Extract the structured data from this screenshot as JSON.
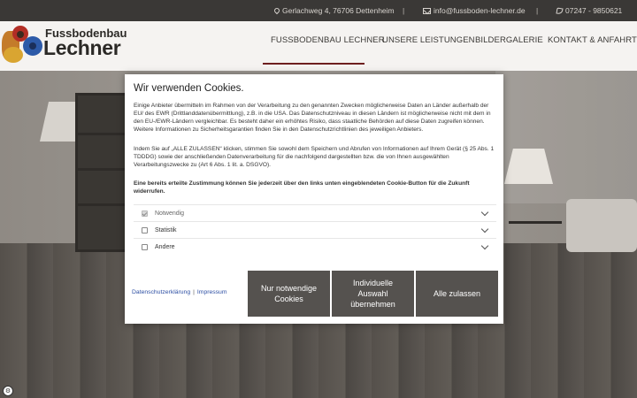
{
  "topbar": {
    "address": "Gerlachweg 4, 76706 Dettenheim",
    "email": "info@fussboden-lechner.de",
    "phone": "07247 - 9850621",
    "separator": "|"
  },
  "brand": {
    "line1": "Fussbodenbau",
    "line2": "Lechner"
  },
  "nav": {
    "items": [
      {
        "label": "FUSSBODENBAU LECHNER"
      },
      {
        "label": "UNSERE LEISTUNGEN"
      },
      {
        "label": "BILDERGALERIE"
      },
      {
        "label": "KONTAKT & ANFAHRT"
      }
    ],
    "accent": "#6e1f1f"
  },
  "cookie": {
    "title": "Wir verwenden Cookies.",
    "para1": "Einige Anbieter übermitteln im Rahmen von der Verarbeitung zu den genannten Zwecken möglicherweise Daten an Länder außerhalb der EU/ des EWR (Drittlanddatenübermittlung), z.B. in die USA. Das Datenschutzniveau in diesen Ländern ist möglicherweise nicht mit dem in den EU-/EWR-Ländern vergleichbar. Es besteht daher ein erhöhtes Risiko, dass staatliche Behörden auf diese Daten zugreifen können. Weitere Informationen zu Sicherheitsgarantien finden Sie in den Datenschutzrichtlinien des jeweiligen Anbieters.",
    "para2": "Indem Sie auf „ALLE ZULASSEN“ klicken, stimmen Sie sowohl dem Speichern und Abrufen von Informationen auf Ihrem Gerät (§ 25 Abs. 1 TDDDG) sowie der anschließenden Datenverarbeitung für die nachfolgend dargestellten bzw. die von Ihnen ausgewählten Verarbeitungszwecke zu (Art 6 Abs. 1 lit. a. DSGVO).",
    "para3": "Eine bereits erteilte Zustimmung können Sie jederzeit über den links unten eingeblendeten Cookie-Button für die Zukunft widerrufen.",
    "options": [
      {
        "label": "Notwendig",
        "checked": true
      },
      {
        "label": "Statistik",
        "checked": false
      },
      {
        "label": "Andere",
        "checked": false
      }
    ],
    "link_privacy": "Datenschutzerklärung",
    "link_separator": "|",
    "link_imprint": "Impressum",
    "btn_necessary": "Nur notwendige Cookies",
    "btn_individual": "Individuelle Auswahl übernehmen",
    "btn_all": "Alle zulassen"
  },
  "cookie_badge": {
    "icon": "cookie-settings-icon",
    "glyph": "⚙"
  }
}
